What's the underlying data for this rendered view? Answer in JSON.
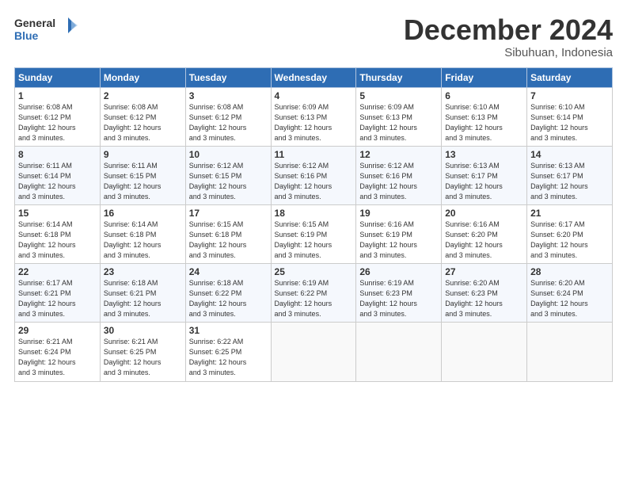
{
  "logo": {
    "general": "General",
    "blue": "Blue"
  },
  "header": {
    "month": "December 2024",
    "location": "Sibuhuan, Indonesia"
  },
  "days_of_week": [
    "Sunday",
    "Monday",
    "Tuesday",
    "Wednesday",
    "Thursday",
    "Friday",
    "Saturday"
  ],
  "weeks": [
    [
      {
        "day": "1",
        "info": "Sunrise: 6:08 AM\nSunset: 6:12 PM\nDaylight: 12 hours\nand 3 minutes."
      },
      {
        "day": "2",
        "info": "Sunrise: 6:08 AM\nSunset: 6:12 PM\nDaylight: 12 hours\nand 3 minutes."
      },
      {
        "day": "3",
        "info": "Sunrise: 6:08 AM\nSunset: 6:12 PM\nDaylight: 12 hours\nand 3 minutes."
      },
      {
        "day": "4",
        "info": "Sunrise: 6:09 AM\nSunset: 6:13 PM\nDaylight: 12 hours\nand 3 minutes."
      },
      {
        "day": "5",
        "info": "Sunrise: 6:09 AM\nSunset: 6:13 PM\nDaylight: 12 hours\nand 3 minutes."
      },
      {
        "day": "6",
        "info": "Sunrise: 6:10 AM\nSunset: 6:13 PM\nDaylight: 12 hours\nand 3 minutes."
      },
      {
        "day": "7",
        "info": "Sunrise: 6:10 AM\nSunset: 6:14 PM\nDaylight: 12 hours\nand 3 minutes."
      }
    ],
    [
      {
        "day": "8",
        "info": "Sunrise: 6:11 AM\nSunset: 6:14 PM\nDaylight: 12 hours\nand 3 minutes."
      },
      {
        "day": "9",
        "info": "Sunrise: 6:11 AM\nSunset: 6:15 PM\nDaylight: 12 hours\nand 3 minutes."
      },
      {
        "day": "10",
        "info": "Sunrise: 6:12 AM\nSunset: 6:15 PM\nDaylight: 12 hours\nand 3 minutes."
      },
      {
        "day": "11",
        "info": "Sunrise: 6:12 AM\nSunset: 6:16 PM\nDaylight: 12 hours\nand 3 minutes."
      },
      {
        "day": "12",
        "info": "Sunrise: 6:12 AM\nSunset: 6:16 PM\nDaylight: 12 hours\nand 3 minutes."
      },
      {
        "day": "13",
        "info": "Sunrise: 6:13 AM\nSunset: 6:17 PM\nDaylight: 12 hours\nand 3 minutes."
      },
      {
        "day": "14",
        "info": "Sunrise: 6:13 AM\nSunset: 6:17 PM\nDaylight: 12 hours\nand 3 minutes."
      }
    ],
    [
      {
        "day": "15",
        "info": "Sunrise: 6:14 AM\nSunset: 6:18 PM\nDaylight: 12 hours\nand 3 minutes."
      },
      {
        "day": "16",
        "info": "Sunrise: 6:14 AM\nSunset: 6:18 PM\nDaylight: 12 hours\nand 3 minutes."
      },
      {
        "day": "17",
        "info": "Sunrise: 6:15 AM\nSunset: 6:18 PM\nDaylight: 12 hours\nand 3 minutes."
      },
      {
        "day": "18",
        "info": "Sunrise: 6:15 AM\nSunset: 6:19 PM\nDaylight: 12 hours\nand 3 minutes."
      },
      {
        "day": "19",
        "info": "Sunrise: 6:16 AM\nSunset: 6:19 PM\nDaylight: 12 hours\nand 3 minutes."
      },
      {
        "day": "20",
        "info": "Sunrise: 6:16 AM\nSunset: 6:20 PM\nDaylight: 12 hours\nand 3 minutes."
      },
      {
        "day": "21",
        "info": "Sunrise: 6:17 AM\nSunset: 6:20 PM\nDaylight: 12 hours\nand 3 minutes."
      }
    ],
    [
      {
        "day": "22",
        "info": "Sunrise: 6:17 AM\nSunset: 6:21 PM\nDaylight: 12 hours\nand 3 minutes."
      },
      {
        "day": "23",
        "info": "Sunrise: 6:18 AM\nSunset: 6:21 PM\nDaylight: 12 hours\nand 3 minutes."
      },
      {
        "day": "24",
        "info": "Sunrise: 6:18 AM\nSunset: 6:22 PM\nDaylight: 12 hours\nand 3 minutes."
      },
      {
        "day": "25",
        "info": "Sunrise: 6:19 AM\nSunset: 6:22 PM\nDaylight: 12 hours\nand 3 minutes."
      },
      {
        "day": "26",
        "info": "Sunrise: 6:19 AM\nSunset: 6:23 PM\nDaylight: 12 hours\nand 3 minutes."
      },
      {
        "day": "27",
        "info": "Sunrise: 6:20 AM\nSunset: 6:23 PM\nDaylight: 12 hours\nand 3 minutes."
      },
      {
        "day": "28",
        "info": "Sunrise: 6:20 AM\nSunset: 6:24 PM\nDaylight: 12 hours\nand 3 minutes."
      }
    ],
    [
      {
        "day": "29",
        "info": "Sunrise: 6:21 AM\nSunset: 6:24 PM\nDaylight: 12 hours\nand 3 minutes."
      },
      {
        "day": "30",
        "info": "Sunrise: 6:21 AM\nSunset: 6:25 PM\nDaylight: 12 hours\nand 3 minutes."
      },
      {
        "day": "31",
        "info": "Sunrise: 6:22 AM\nSunset: 6:25 PM\nDaylight: 12 hours\nand 3 minutes."
      },
      {
        "day": "",
        "info": ""
      },
      {
        "day": "",
        "info": ""
      },
      {
        "day": "",
        "info": ""
      },
      {
        "day": "",
        "info": ""
      }
    ]
  ]
}
